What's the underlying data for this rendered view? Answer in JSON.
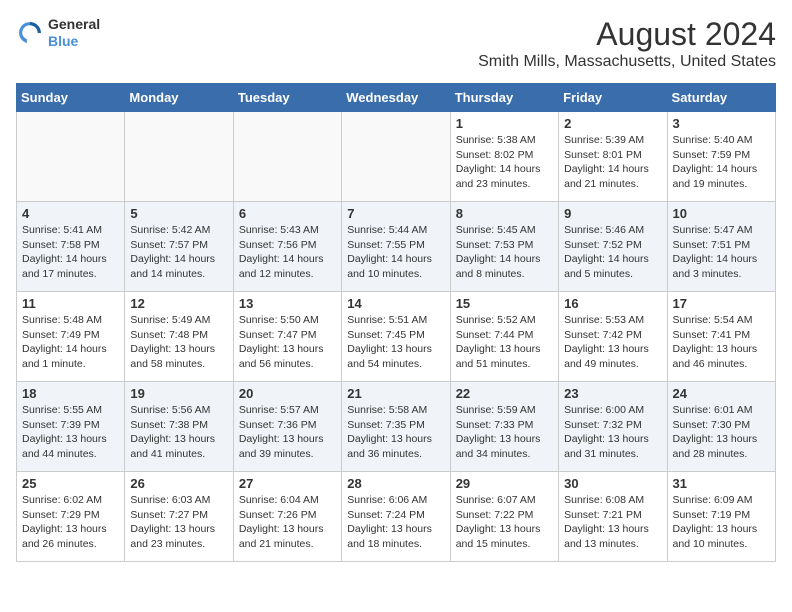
{
  "header": {
    "logo_line1": "General",
    "logo_line2": "Blue",
    "main_title": "August 2024",
    "subtitle": "Smith Mills, Massachusetts, United States"
  },
  "calendar": {
    "days_of_week": [
      "Sunday",
      "Monday",
      "Tuesday",
      "Wednesday",
      "Thursday",
      "Friday",
      "Saturday"
    ],
    "weeks": [
      [
        {
          "day": "",
          "info": ""
        },
        {
          "day": "",
          "info": ""
        },
        {
          "day": "",
          "info": ""
        },
        {
          "day": "",
          "info": ""
        },
        {
          "day": "1",
          "info": "Sunrise: 5:38 AM\nSunset: 8:02 PM\nDaylight: 14 hours and 23 minutes."
        },
        {
          "day": "2",
          "info": "Sunrise: 5:39 AM\nSunset: 8:01 PM\nDaylight: 14 hours and 21 minutes."
        },
        {
          "day": "3",
          "info": "Sunrise: 5:40 AM\nSunset: 7:59 PM\nDaylight: 14 hours and 19 minutes."
        }
      ],
      [
        {
          "day": "4",
          "info": "Sunrise: 5:41 AM\nSunset: 7:58 PM\nDaylight: 14 hours and 17 minutes."
        },
        {
          "day": "5",
          "info": "Sunrise: 5:42 AM\nSunset: 7:57 PM\nDaylight: 14 hours and 14 minutes."
        },
        {
          "day": "6",
          "info": "Sunrise: 5:43 AM\nSunset: 7:56 PM\nDaylight: 14 hours and 12 minutes."
        },
        {
          "day": "7",
          "info": "Sunrise: 5:44 AM\nSunset: 7:55 PM\nDaylight: 14 hours and 10 minutes."
        },
        {
          "day": "8",
          "info": "Sunrise: 5:45 AM\nSunset: 7:53 PM\nDaylight: 14 hours and 8 minutes."
        },
        {
          "day": "9",
          "info": "Sunrise: 5:46 AM\nSunset: 7:52 PM\nDaylight: 14 hours and 5 minutes."
        },
        {
          "day": "10",
          "info": "Sunrise: 5:47 AM\nSunset: 7:51 PM\nDaylight: 14 hours and 3 minutes."
        }
      ],
      [
        {
          "day": "11",
          "info": "Sunrise: 5:48 AM\nSunset: 7:49 PM\nDaylight: 14 hours and 1 minute."
        },
        {
          "day": "12",
          "info": "Sunrise: 5:49 AM\nSunset: 7:48 PM\nDaylight: 13 hours and 58 minutes."
        },
        {
          "day": "13",
          "info": "Sunrise: 5:50 AM\nSunset: 7:47 PM\nDaylight: 13 hours and 56 minutes."
        },
        {
          "day": "14",
          "info": "Sunrise: 5:51 AM\nSunset: 7:45 PM\nDaylight: 13 hours and 54 minutes."
        },
        {
          "day": "15",
          "info": "Sunrise: 5:52 AM\nSunset: 7:44 PM\nDaylight: 13 hours and 51 minutes."
        },
        {
          "day": "16",
          "info": "Sunrise: 5:53 AM\nSunset: 7:42 PM\nDaylight: 13 hours and 49 minutes."
        },
        {
          "day": "17",
          "info": "Sunrise: 5:54 AM\nSunset: 7:41 PM\nDaylight: 13 hours and 46 minutes."
        }
      ],
      [
        {
          "day": "18",
          "info": "Sunrise: 5:55 AM\nSunset: 7:39 PM\nDaylight: 13 hours and 44 minutes."
        },
        {
          "day": "19",
          "info": "Sunrise: 5:56 AM\nSunset: 7:38 PM\nDaylight: 13 hours and 41 minutes."
        },
        {
          "day": "20",
          "info": "Sunrise: 5:57 AM\nSunset: 7:36 PM\nDaylight: 13 hours and 39 minutes."
        },
        {
          "day": "21",
          "info": "Sunrise: 5:58 AM\nSunset: 7:35 PM\nDaylight: 13 hours and 36 minutes."
        },
        {
          "day": "22",
          "info": "Sunrise: 5:59 AM\nSunset: 7:33 PM\nDaylight: 13 hours and 34 minutes."
        },
        {
          "day": "23",
          "info": "Sunrise: 6:00 AM\nSunset: 7:32 PM\nDaylight: 13 hours and 31 minutes."
        },
        {
          "day": "24",
          "info": "Sunrise: 6:01 AM\nSunset: 7:30 PM\nDaylight: 13 hours and 28 minutes."
        }
      ],
      [
        {
          "day": "25",
          "info": "Sunrise: 6:02 AM\nSunset: 7:29 PM\nDaylight: 13 hours and 26 minutes."
        },
        {
          "day": "26",
          "info": "Sunrise: 6:03 AM\nSunset: 7:27 PM\nDaylight: 13 hours and 23 minutes."
        },
        {
          "day": "27",
          "info": "Sunrise: 6:04 AM\nSunset: 7:26 PM\nDaylight: 13 hours and 21 minutes."
        },
        {
          "day": "28",
          "info": "Sunrise: 6:06 AM\nSunset: 7:24 PM\nDaylight: 13 hours and 18 minutes."
        },
        {
          "day": "29",
          "info": "Sunrise: 6:07 AM\nSunset: 7:22 PM\nDaylight: 13 hours and 15 minutes."
        },
        {
          "day": "30",
          "info": "Sunrise: 6:08 AM\nSunset: 7:21 PM\nDaylight: 13 hours and 13 minutes."
        },
        {
          "day": "31",
          "info": "Sunrise: 6:09 AM\nSunset: 7:19 PM\nDaylight: 13 hours and 10 minutes."
        }
      ]
    ]
  }
}
